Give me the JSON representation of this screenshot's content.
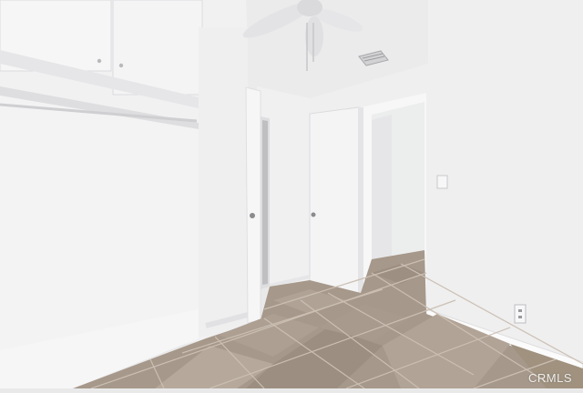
{
  "scene": {
    "description_label": "",
    "colors": {
      "wall": "#f2f2f3",
      "wall_shadow": "#e2e3e5",
      "ceiling": "#ececed",
      "floor_light": "#b3a597",
      "floor_dark": "#8f8173",
      "grout": "#c9beb2",
      "trim": "#fafafa",
      "door": "#f5f5f6"
    },
    "icons": [
      "ceiling-fan-icon",
      "air-vent-icon",
      "door-knob-icon",
      "light-switch-icon",
      "wall-outlet-icon"
    ]
  },
  "watermark": {
    "text": "CRMLS"
  }
}
